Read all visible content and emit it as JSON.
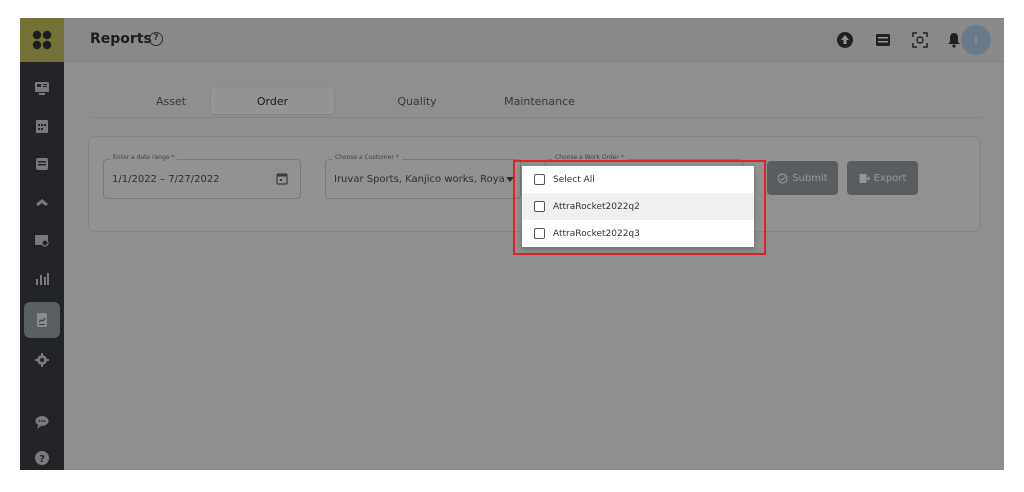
{
  "header": {
    "title": "Reports",
    "help_glyph": "?",
    "avatar_initial": "I",
    "icons": [
      "upload-circle-icon",
      "server-icon",
      "scan-icon",
      "bell-icon"
    ]
  },
  "sidebar": {
    "items": [
      {
        "name": "dashboard-icon"
      },
      {
        "name": "calendar-icon"
      },
      {
        "name": "inbox-icon"
      },
      {
        "name": "asset-icon"
      },
      {
        "name": "image-icon"
      },
      {
        "name": "analytics-icon"
      },
      {
        "name": "reports-icon",
        "active": true
      },
      {
        "name": "settings-icon"
      },
      {
        "name": "chat-icon"
      },
      {
        "name": "help-icon"
      }
    ]
  },
  "tabs": [
    {
      "label": "Asset",
      "active": false
    },
    {
      "label": "Order",
      "active": true
    },
    {
      "label": "Quality",
      "active": false
    },
    {
      "label": "Maintenance",
      "active": false
    }
  ],
  "filters": {
    "date_range": {
      "label": "Enter a date range *",
      "value": "1/1/2022 – 7/27/2022"
    },
    "customer": {
      "label": "Choose a Customer *",
      "value": "Iruvar Sports, Kanjico works, Roya..."
    },
    "work_order": {
      "label": "Choose a Work Order *"
    }
  },
  "buttons": {
    "submit": "Submit",
    "export": "Export"
  },
  "dropdown": {
    "options": [
      {
        "label": "Select All",
        "checked": false
      },
      {
        "label": "AttraRocket2022q2",
        "checked": false
      },
      {
        "label": "AttraRocket2022q3",
        "checked": false
      }
    ]
  },
  "colors": {
    "sidebar": "#3b3f45",
    "logo_bg": "#c9c35f",
    "highlight": "#e02424",
    "button": "#9aa0a6"
  }
}
